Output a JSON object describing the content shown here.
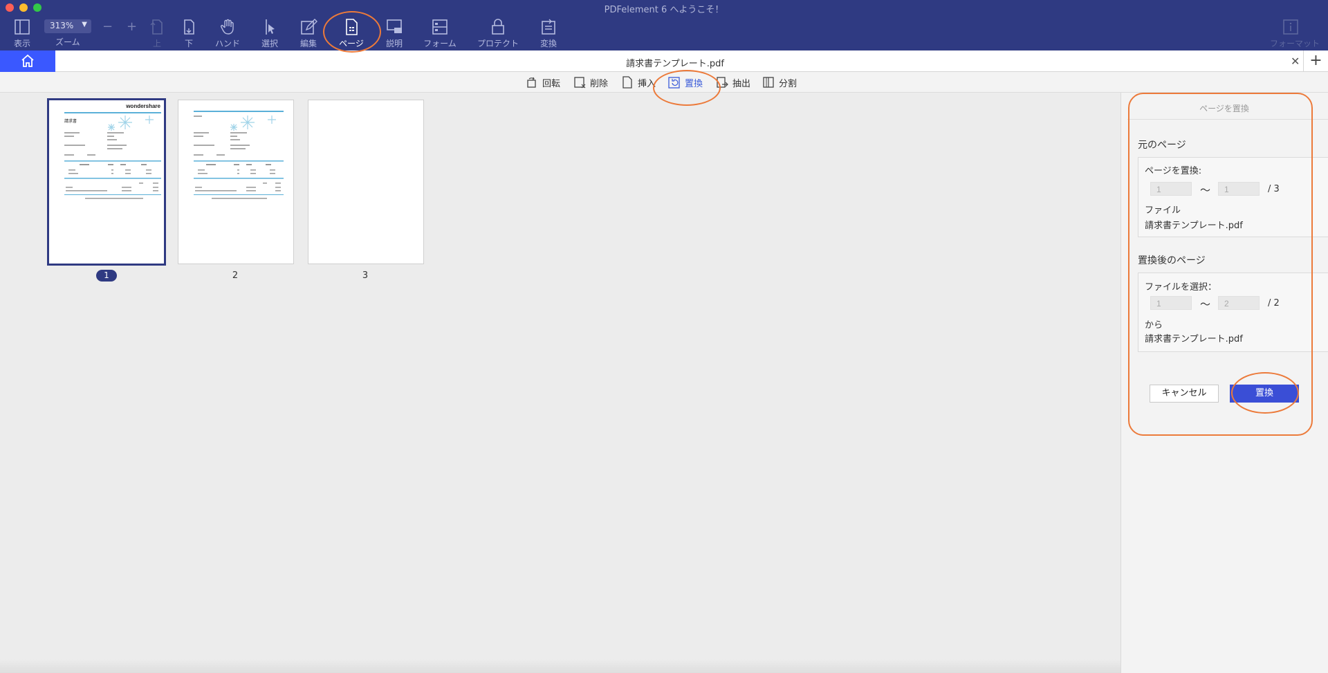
{
  "window": {
    "title": "PDFelement 6 へようこそ！"
  },
  "toolbar": {
    "view": "表示",
    "zoom_value": "313%",
    "zoom_label": "ズーム",
    "zoom_minus": "−",
    "zoom_plus": "+",
    "up": "上",
    "down": "下",
    "hand": "ハンド",
    "select": "選択",
    "edit": "編集",
    "page": "ページ",
    "comment": "説明",
    "form": "フォーム",
    "protect": "プロテクト",
    "convert": "変換",
    "format": "フォーマット"
  },
  "tab": {
    "title": "請求書テンプレート.pdf",
    "close": "✕",
    "add": "+"
  },
  "page_tools": {
    "rotate": "回転",
    "delete": "削除",
    "insert": "挿入",
    "replace": "置換",
    "extract": "抽出",
    "split": "分割"
  },
  "thumbnails": {
    "page1": "1",
    "page2": "2",
    "page3": "3",
    "brand": "wondershare",
    "doc_heading": "請求書"
  },
  "panel": {
    "title": "ページを置換",
    "original_heading": "元のページ",
    "replace_pages_label": "ページを置換:",
    "orig_from": "1",
    "orig_to": "1",
    "tilde": "〜",
    "orig_total": "/ 3",
    "file_label": "ファイル",
    "file_name": "請求書テンプレート.pdf",
    "after_heading": "置換後のページ",
    "choose_file_label": "ファイルを選択：",
    "new_from": "1",
    "new_to": "2",
    "new_total": "/ 2",
    "from_label": "から",
    "from_file": "請求書テンプレート.pdf",
    "cancel": "キャンセル",
    "replace": "置換"
  },
  "colors": {
    "toolbar_bg": "#2f3a82",
    "accent_blue": "#3a58ff",
    "annotation_orange": "#ec7a3a"
  }
}
